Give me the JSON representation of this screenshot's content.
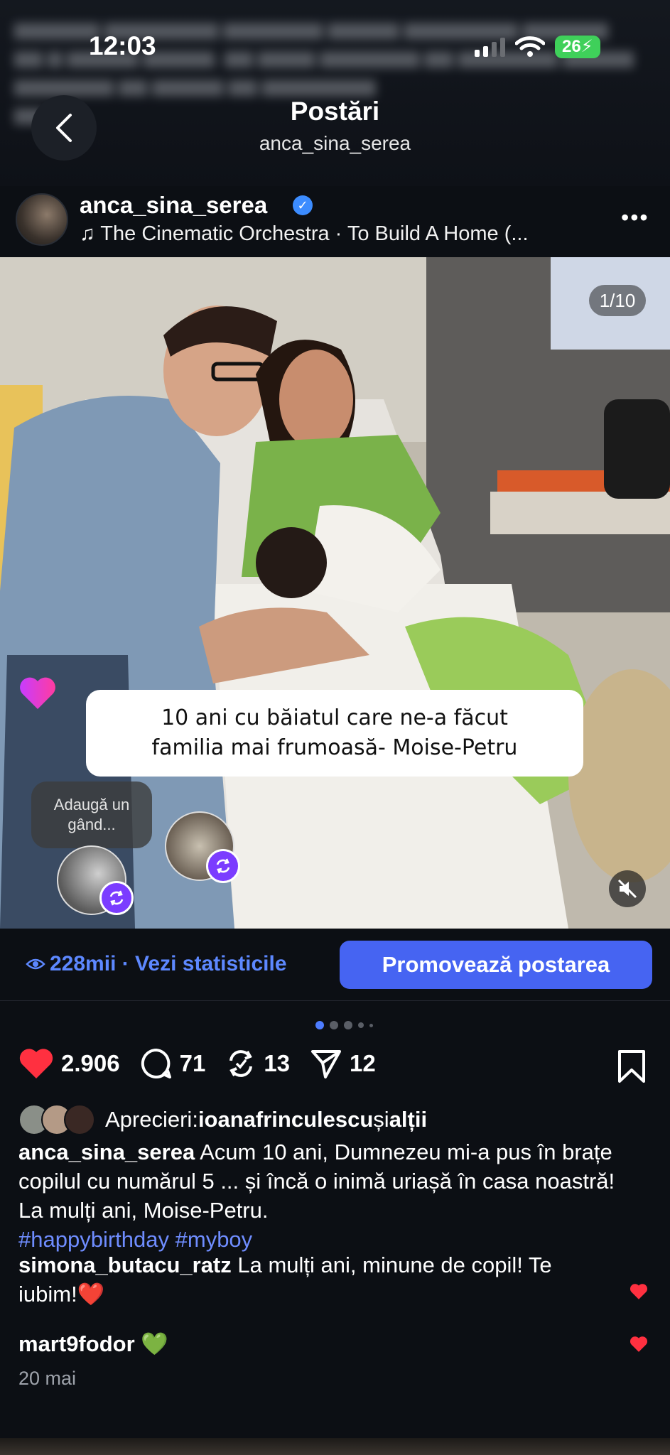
{
  "status_bar": {
    "time": "12:03",
    "battery": "26"
  },
  "header": {
    "title": "Postări",
    "subtitle": "anca_sina_serea"
  },
  "post": {
    "username": "anca_sina_serea",
    "music": "The Cinematic Orchestra · To Build A Home (...",
    "more": "•••",
    "media_counter": "1/10",
    "image_caption_line1": "10 ani cu băiatul care ne-a făcut",
    "image_caption_line2": "familia mai frumoasă- Moise-Petru",
    "thought_line1": "Adaugă un",
    "thought_line2": "gând..."
  },
  "insights": {
    "views": "228mii · Vezi statisticile",
    "promote_label": "Promovează postarea"
  },
  "carousel": {
    "current_index": 1,
    "total_dots": 5
  },
  "actions": {
    "likes": "2.906",
    "comments": "71",
    "reposts": "13",
    "shares": "12"
  },
  "likes_row": {
    "prefix": "Aprecieri: ",
    "liker": "ioanafrinculescu",
    "conjunction": " și ",
    "others": "alții"
  },
  "caption": {
    "author": "anca_sina_serea",
    "text": " Acum 10 ani, Dumnezeu mi-a pus în brațe copilul cu numărul 5 ... și încă o inimă uriașă în casa noastră! La mulți ani, Moise-Petru.",
    "hashtag1": "#happybirthday",
    "hashtag2": "#myboy"
  },
  "comments": [
    {
      "author": "simona_butacu_ratz",
      "text": " La mulți ani, minune de copil! Te iubim!❤️"
    },
    {
      "author": "mart9fodor",
      "text": " 💚"
    }
  ],
  "date": "20 mai",
  "colors": {
    "accent": "#4664f2",
    "link": "#5d88ff",
    "like": "#ff3040",
    "verified": "#3c8cff"
  }
}
